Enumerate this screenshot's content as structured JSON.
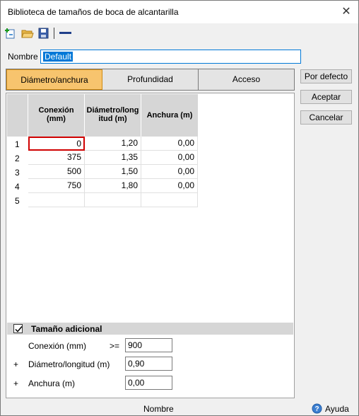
{
  "window": {
    "title": "Biblioteca de tamaños de boca de alcantarilla"
  },
  "toolbar": {
    "icons": [
      "add-icon",
      "open-folder-icon",
      "save-icon",
      "line-icon"
    ]
  },
  "name_field": {
    "label": "Nombre",
    "value": "Default"
  },
  "tabs": [
    {
      "label": "Diámetro/anchura",
      "active": true
    },
    {
      "label": "Profundidad",
      "active": false
    },
    {
      "label": "Acceso",
      "active": false
    }
  ],
  "buttons": {
    "default": "Por defecto",
    "accept": "Aceptar",
    "cancel": "Cancelar"
  },
  "table": {
    "headers": [
      {
        "line1": "Conexión",
        "line2": "(mm)"
      },
      {
        "line1": "Diámetro/long",
        "line2": "itud (m)"
      },
      {
        "line1": "Anchura (m)",
        "line2": ""
      }
    ],
    "rows": [
      {
        "num": "1",
        "cells": [
          "0",
          "1,20",
          "0,00"
        ]
      },
      {
        "num": "2",
        "cells": [
          "375",
          "1,35",
          "0,00"
        ]
      },
      {
        "num": "3",
        "cells": [
          "500",
          "1,50",
          "0,00"
        ]
      },
      {
        "num": "4",
        "cells": [
          "750",
          "1,80",
          "0,00"
        ]
      },
      {
        "num": "5",
        "cells": [
          "",
          "",
          ""
        ]
      }
    ]
  },
  "additional": {
    "title": "Tamaño adicional",
    "checked": true,
    "connection_label": "Conexión (mm)",
    "operator": ">=",
    "connection_value": "900",
    "diameter_prefix": "+",
    "diameter_label": "Diámetro/longitud (m)",
    "diameter_value": "0,90",
    "width_prefix": "+",
    "width_label": "Anchura (m)",
    "width_value": "0,00"
  },
  "status": {
    "name": "Nombre",
    "help": "Ayuda"
  },
  "colors": {
    "active_tab": "#f7c46e",
    "selection": "#0078d7",
    "selected_cell_border": "#d00000"
  }
}
